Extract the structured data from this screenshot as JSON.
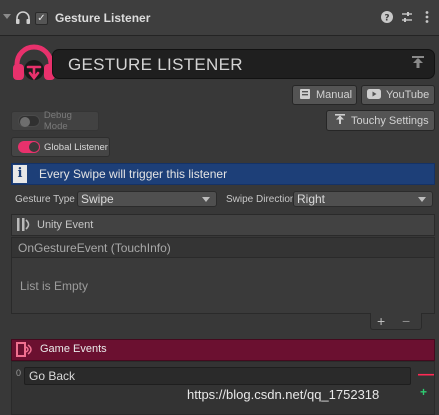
{
  "component": {
    "title": "Gesture Listener",
    "enabled_check": "✓"
  },
  "banner": {
    "title": "GESTURE LISTENER"
  },
  "buttons": {
    "manual": "Manual",
    "youtube": "YouTube",
    "touchy_settings": "Touchy Settings"
  },
  "toggles": {
    "debug_mode": "Debug Mode",
    "global_listener": "Global Listener"
  },
  "info": {
    "text": "Every Swipe will trigger this listener",
    "icon_glyph": "i"
  },
  "fields": {
    "gesture_type_label": "Gesture Type",
    "gesture_type_value": "Swipe",
    "swipe_direction_label": "Swipe Direction",
    "swipe_direction_value": "Right"
  },
  "unity_event": {
    "title": "Unity Event",
    "callback": "OnGestureEvent (TouchInfo)",
    "empty_text": "List is Empty",
    "add_glyph": "+",
    "remove_glyph": "−"
  },
  "game_events": {
    "title": "Game Events",
    "items": [
      {
        "index": "0",
        "value": "Go Back"
      }
    ],
    "remove_glyph": "—"
  },
  "watermark": "https://blog.csdn.net/qq_1752318",
  "watermark_plus": "+",
  "colors": {
    "accent_pink": "#e8316c",
    "game_events_bg": "#6b1030",
    "info_blue": "#1d3f78"
  }
}
